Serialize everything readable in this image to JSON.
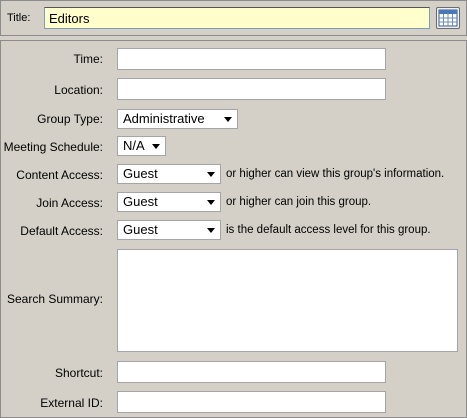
{
  "title_bar": {
    "label": "Title:",
    "value": "Editors",
    "calendar_icon": "calendar-icon"
  },
  "form": {
    "time": {
      "label": "Time:",
      "value": ""
    },
    "location": {
      "label": "Location:",
      "value": ""
    },
    "group_type": {
      "label": "Group Type:",
      "selected": "Administrative"
    },
    "meeting_schedule": {
      "label": "Meeting Schedule:",
      "selected": "N/A"
    },
    "content_access": {
      "label": "Content Access:",
      "selected": "Guest",
      "suffix": "or higher can view this group's information."
    },
    "join_access": {
      "label": "Join Access:",
      "selected": "Guest",
      "suffix": "or higher can join this group."
    },
    "default_access": {
      "label": "Default Access:",
      "selected": "Guest",
      "suffix": "is the default access level for this group."
    },
    "search_summary": {
      "label": "Search Summary:",
      "value": ""
    },
    "shortcut": {
      "label": "Shortcut:",
      "value": ""
    },
    "external_id": {
      "label": "External ID:",
      "value": ""
    }
  },
  "colors": {
    "background": "#d4d0c8",
    "title_input_bg": "#ffffcc",
    "field_bg": "#ffffff"
  }
}
